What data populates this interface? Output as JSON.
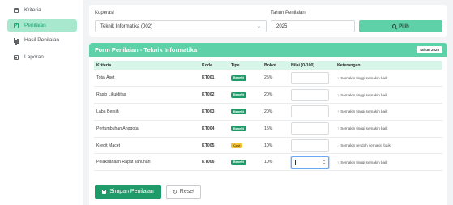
{
  "sidebar": {
    "items": [
      {
        "label": "Kriteria",
        "icon": "list-icon",
        "active": false
      },
      {
        "label": "Penilaian",
        "icon": "edit-icon",
        "active": true
      },
      {
        "label": "Hasil Penilaian",
        "icon": "bar-chart-icon",
        "active": false
      },
      {
        "label": "Laporan",
        "icon": "report-icon",
        "active": false
      }
    ]
  },
  "filter": {
    "koperasi_label": "Koperasi",
    "koperasi_value": "Teknik Informatika (002)",
    "tahun_label": "Tahun Penilaian",
    "tahun_value": "2025",
    "pilih_label": "Pilih"
  },
  "form": {
    "title": "Form Penilaian - Teknik Informatika",
    "year_badge": "Tahun 2025",
    "columns": [
      "Kriteria",
      "Kode",
      "Tipe",
      "Bobot",
      "Nilai (0-100)",
      "Keterangan"
    ],
    "rows": [
      {
        "kriteria": "Total Aset",
        "kode": "KT001",
        "tipe": "Benefit",
        "bobot": "25%",
        "keterangan": "Semakin tinggi semakin baik"
      },
      {
        "kriteria": "Rasio Likuiditas",
        "kode": "KT002",
        "tipe": "Benefit",
        "bobot": "20%",
        "keterangan": "Semakin tinggi semakin baik"
      },
      {
        "kriteria": "Laba Bersih",
        "kode": "KT003",
        "tipe": "Benefit",
        "bobot": "20%",
        "keterangan": "Semakin tinggi semakin baik"
      },
      {
        "kriteria": "Pertumbuhan Anggota",
        "kode": "KT004",
        "tipe": "Benefit",
        "bobot": "15%",
        "keterangan": "Semakin tinggi semakin baik"
      },
      {
        "kriteria": "Kredit Macet",
        "kode": "KT005",
        "tipe": "Cost",
        "bobot": "10%",
        "keterangan": "Semakin rendah semakin baik"
      },
      {
        "kriteria": "Pelaksanaan Rapat Tahunan",
        "kode": "KT006",
        "tipe": "Benefit",
        "bobot": "10%",
        "keterangan": "Semakin tinggi semakin baik"
      }
    ],
    "save_label": "Simpan Penilaian",
    "reset_label": "Reset"
  },
  "colors": {
    "accent": "#5fd1a8",
    "benefit": "#1f9b6a",
    "cost": "#f3c23c"
  }
}
